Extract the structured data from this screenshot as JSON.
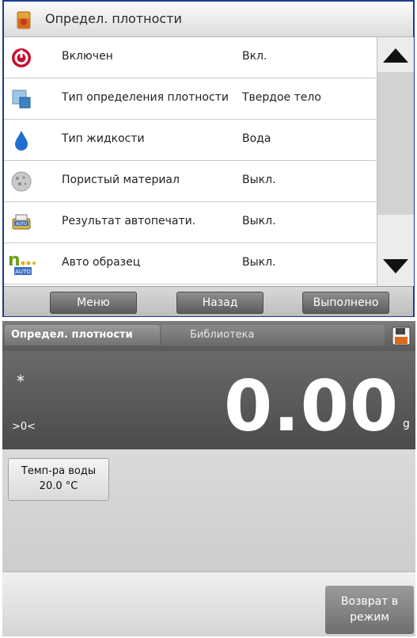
{
  "top_panel": {
    "title": "Определ. плотности",
    "rows": [
      {
        "label": "Включен",
        "value": "Вкл.",
        "icon": "power-icon"
      },
      {
        "label": "Тип определения плотности",
        "value": "Твердое тело",
        "icon": "cube-water-icon"
      },
      {
        "label": "Тип жидкости",
        "value": "Вода",
        "icon": "water-drop-icon"
      },
      {
        "label": "Пористый материал",
        "value": "Выкл.",
        "icon": "porous-stone-icon"
      },
      {
        "label": "Результат автопечати.",
        "value": "Выкл.",
        "icon": "auto-print-icon"
      },
      {
        "label": "Авто образец",
        "value": "Выкл.",
        "icon": "auto-sample-icon"
      }
    ],
    "footer": {
      "menu": "Меню",
      "back": "Назад",
      "done": "Выполнено"
    }
  },
  "bottom_panel": {
    "tabs": {
      "active": "Определ. плотности",
      "library": "Библиотека"
    },
    "display": {
      "stability_mark": "*",
      "zero_indicator": ">0<",
      "reading": "0.00",
      "unit": "g"
    },
    "water_temp": {
      "label": "Темп-ра воды",
      "value": "20.0 °C"
    },
    "return_button": {
      "line1": "Возврат в",
      "line2": "режим"
    }
  }
}
